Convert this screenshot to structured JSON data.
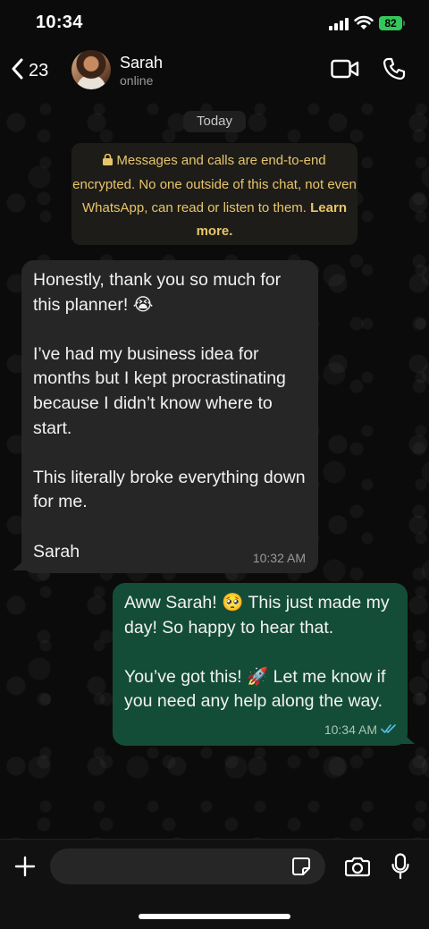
{
  "status_bar": {
    "time": "10:34",
    "battery": "82"
  },
  "header": {
    "back_count": "23",
    "contact_name": "Sarah",
    "contact_status": "online"
  },
  "chat": {
    "date_label": "Today",
    "encryption_notice": "Messages and calls are end-to-end encrypted. No one outside of this chat, not even WhatsApp, can read or listen to them.",
    "encryption_link": "Learn more.",
    "messages": [
      {
        "direction": "incoming",
        "text": "Honestly, thank you so much for this planner! 😭\n\nI’ve had my business idea for months but I kept procrastinating because I didn’t know where to start.\n\nThis literally broke everything down for me.\n\nSarah",
        "time": "10:32 AM"
      },
      {
        "direction": "outgoing",
        "text": "Aww Sarah! 🥺 This just made my day! So happy to hear that.\n\nYou’ve got this! 🚀 Let me know if you need any help along the way.",
        "time": "10:34 AM",
        "status": "read"
      }
    ]
  },
  "composer": {
    "placeholder": ""
  },
  "colors": {
    "background": "#0b0b0b",
    "incoming_bubble": "#262626",
    "outgoing_bubble": "#144d37",
    "notice_text": "#e8c56a",
    "read_ticks": "#53bdeb"
  }
}
